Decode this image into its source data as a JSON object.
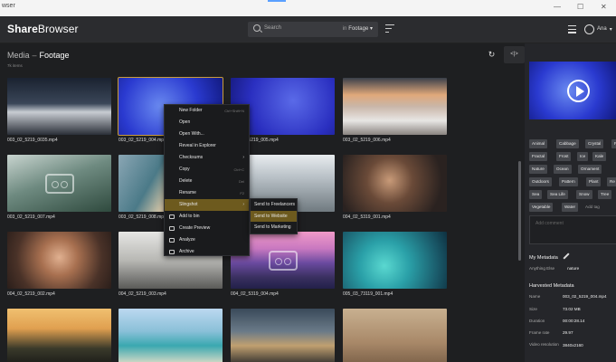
{
  "window": {
    "title": "wser"
  },
  "topbar": {
    "logo_a": "Share",
    "logo_b": "Browser",
    "search_placeholder": "Search",
    "search_in": "in",
    "search_scope": "Footage",
    "user": "Ana"
  },
  "main": {
    "crumb_root": "Media",
    "crumb_sep": "–",
    "crumb_current": "Footage",
    "item_count": "7k items",
    "collapse_label": "<|>"
  },
  "files": [
    "003_02_5219_0035.mp4",
    "003_02_5219_004.mp4",
    "003_02_5219_005.mp4",
    "003_02_5219_006.mp4",
    "003_02_5219_007.mp4",
    "003_02_5219_008.mp4",
    "",
    "004_02_5319_001.mp4",
    "004_02_5219_002.mp4",
    "004_02_5219_003.mp4",
    "004_02_5319_004.mp4",
    "005_03_73119_001.mp4",
    "",
    "",
    "",
    ""
  ],
  "context_menu": {
    "items": [
      {
        "label": "New Folder",
        "kb": "Ctrl+Shift+N"
      },
      {
        "label": "Open",
        "kb": ""
      },
      {
        "label": "Open With...",
        "kb": ""
      },
      {
        "label": "Reveal in Explorer",
        "kb": ""
      },
      {
        "label": "Checksums",
        "kb": ""
      },
      {
        "label": "Copy",
        "kb": "Ctrl+C"
      },
      {
        "label": "Delete",
        "kb": "Del"
      },
      {
        "label": "Rename",
        "kb": "F2"
      },
      {
        "label": "Slingshot",
        "kb": ""
      },
      {
        "label": "Add to bin",
        "kb": ""
      },
      {
        "label": "Create Preview",
        "kb": ""
      },
      {
        "label": "Analyze",
        "kb": ""
      },
      {
        "label": "Archive",
        "kb": ""
      }
    ],
    "submenu": [
      "Send to Freelancers",
      "Send to Website",
      "Send to Marketing"
    ]
  },
  "panel": {
    "tags": [
      "Animal",
      "Cabbage",
      "Crystal",
      "Fo",
      "Fractal",
      "Frost",
      "Ice",
      "Kale",
      "Nature",
      "Ocean",
      "Ornament",
      "Outdoors",
      "Pattern",
      "Plant",
      "Re",
      "Sea",
      "Sea Life",
      "Snow",
      "Tree",
      "Vegetable",
      "Water"
    ],
    "add_tag": "Add tag",
    "comment_placeholder": "Add comment",
    "my_metadata": "My Metadata",
    "anything_label": "Anything Else",
    "anything_value": "nature",
    "harvested": "Harvested Metadata",
    "meta": [
      {
        "k": "Name",
        "v": "003_02_5219_004.mp4"
      },
      {
        "k": "Size",
        "v": "73.02 MB"
      },
      {
        "k": "Duration",
        "v": "00:00:28.14"
      },
      {
        "k": "Frame rate",
        "v": "29.97"
      },
      {
        "k": "Video resolution",
        "v": "3840x2160"
      }
    ]
  }
}
